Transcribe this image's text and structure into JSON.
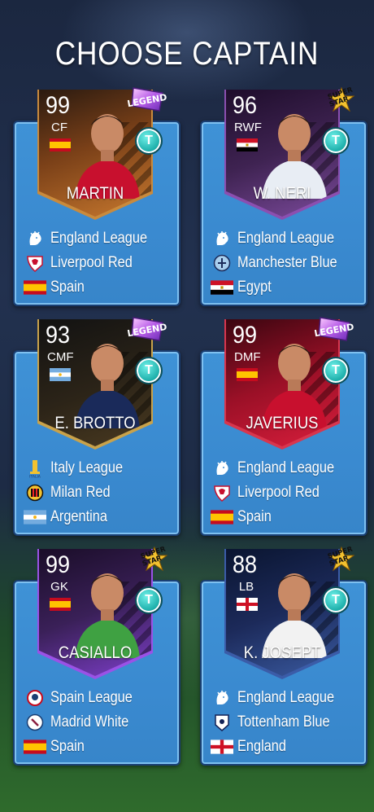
{
  "title": "CHOOSE CAPTAIN",
  "cards": [
    {
      "rating": "99",
      "position": "CF",
      "name": "MARTIN",
      "rarity": "LEGEND",
      "country_flag": "spain",
      "league": "England League",
      "club": "Liverpool Red",
      "country": "Spain",
      "league_icon": "lion-icon",
      "club_icon": "liverpool-crest-icon",
      "flag_icon": "spain-flag-icon",
      "theme": "bronze"
    },
    {
      "rating": "96",
      "position": "RWF",
      "name": "W. NERI",
      "rarity": "SUPER STAR",
      "country_flag": "egypt",
      "league": "England League",
      "club": "Manchester Blue",
      "country": "Egypt",
      "league_icon": "lion-icon",
      "club_icon": "manchester-crest-icon",
      "flag_icon": "egypt-flag-icon",
      "theme": "purple"
    },
    {
      "rating": "93",
      "position": "CMF",
      "name": "E. BROTTO",
      "rarity": "LEGEND",
      "country_flag": "argentina",
      "league": "Italy League",
      "club": "Milan Red",
      "country": "Argentina",
      "league_icon": "italy-league-icon",
      "club_icon": "milan-crest-icon",
      "flag_icon": "argentina-flag-icon",
      "theme": "dark"
    },
    {
      "rating": "99",
      "position": "DMF",
      "name": "JAVERIUS",
      "rarity": "LEGEND",
      "country_flag": "spain",
      "league": "England League",
      "club": "Liverpool Red",
      "country": "Spain",
      "league_icon": "lion-icon",
      "club_icon": "liverpool-crest-icon",
      "flag_icon": "spain-flag-icon",
      "theme": "red"
    },
    {
      "rating": "99",
      "position": "GK",
      "name": "CASIALLO",
      "rarity": "SUPER STAR",
      "country_flag": "spain",
      "league": "Spain League",
      "club": "Madrid White",
      "country": "Spain",
      "league_icon": "spain-league-icon",
      "club_icon": "madrid-crest-icon",
      "flag_icon": "spain-flag-icon",
      "theme": "purple2"
    },
    {
      "rating": "88",
      "position": "LB",
      "name": "K. JOSEPT",
      "rarity": "SUPER STAR",
      "country_flag": "england",
      "league": "England League",
      "club": "Tottenham Blue",
      "country": "England",
      "league_icon": "lion-icon",
      "club_icon": "tottenham-crest-icon",
      "flag_icon": "england-flag-icon",
      "theme": "blue"
    }
  ],
  "badge_letter": "T",
  "rarity_labels": {
    "legend": "LEGEND",
    "super_top": "SUPER",
    "super_bottom": "STAR"
  },
  "colors": {
    "card_blue": "#3a8ad0",
    "legend_badge": "#d67cf0",
    "superstar_badge": "#f2c230",
    "t_badge": "#16a9a5"
  }
}
